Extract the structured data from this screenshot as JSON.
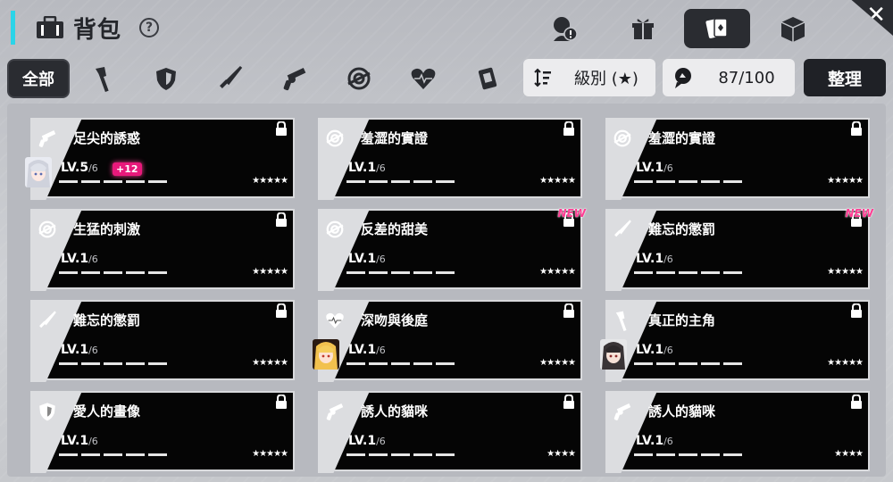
{
  "header": {
    "title": "背包",
    "help": "?"
  },
  "filters": {
    "all_label": "全部",
    "icons": [
      "axe-icon",
      "shield-icon",
      "knife-icon",
      "revolver-icon",
      "target-icon",
      "heart-icon",
      "card-icon"
    ]
  },
  "sort": {
    "label": "級別 (★)"
  },
  "capacity": {
    "label": "87/100"
  },
  "organize": {
    "label": "整理"
  },
  "colors": {
    "accent": "#2bd4e8",
    "new_badge": "#ff3d93",
    "plus_badge": "#e8197b"
  },
  "cards": [
    {
      "name": "足尖的誘惑",
      "icon": "revolver-icon",
      "lv": "LV.5",
      "max": "/6",
      "plus": "+12",
      "stars": "★★★★★",
      "avatar": "silver"
    },
    {
      "name": "羞澀的實證",
      "icon": "target-icon",
      "lv": "LV.1",
      "max": "/6",
      "plus": "",
      "stars": "★★★★★",
      "avatar": ""
    },
    {
      "name": "羞澀的實證",
      "icon": "target-icon",
      "lv": "LV.1",
      "max": "/6",
      "plus": "",
      "stars": "★★★★★",
      "avatar": ""
    },
    {
      "name": "生猛的刺激",
      "icon": "target-icon",
      "lv": "LV.1",
      "max": "/6",
      "plus": "",
      "stars": "★★★★★",
      "avatar": ""
    },
    {
      "name": "反差的甜美",
      "icon": "target-icon",
      "lv": "LV.1",
      "max": "/6",
      "plus": "",
      "stars": "★★★★★",
      "avatar": "",
      "new": "NEW"
    },
    {
      "name": "難忘的懲罰",
      "icon": "knife-icon",
      "lv": "LV.1",
      "max": "/6",
      "plus": "",
      "stars": "★★★★★",
      "avatar": "",
      "new": "NEW"
    },
    {
      "name": "難忘的懲罰",
      "icon": "knife-icon",
      "lv": "LV.1",
      "max": "/6",
      "plus": "",
      "stars": "★★★★★",
      "avatar": ""
    },
    {
      "name": "深吻與後庭",
      "icon": "heart-icon",
      "lv": "LV.1",
      "max": "/6",
      "plus": "",
      "stars": "★★★★★",
      "avatar": "blonde"
    },
    {
      "name": "真正的主角",
      "icon": "axe-icon",
      "lv": "LV.1",
      "max": "/6",
      "plus": "",
      "stars": "★★★★★",
      "avatar": "dark"
    },
    {
      "name": "愛人的畫像",
      "icon": "shield-icon",
      "lv": "LV.1",
      "max": "/6",
      "plus": "",
      "stars": "★★★★★",
      "avatar": ""
    },
    {
      "name": "誘人的貓咪",
      "icon": "revolver-icon",
      "lv": "LV.1",
      "max": "/6",
      "plus": "",
      "stars": "★★★★",
      "avatar": ""
    },
    {
      "name": "誘人的貓咪",
      "icon": "revolver-icon",
      "lv": "LV.1",
      "max": "/6",
      "plus": "",
      "stars": "★★★★",
      "avatar": ""
    }
  ]
}
